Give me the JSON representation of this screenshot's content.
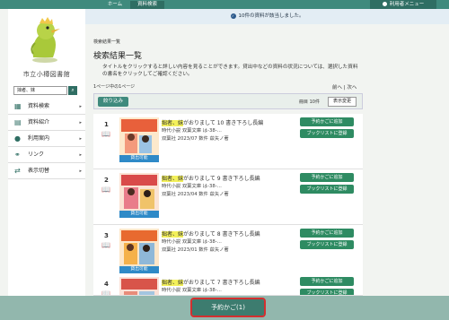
{
  "topnav": {
    "home": "ホーム",
    "search": "資料検索",
    "user_menu": "利用者メニュー"
  },
  "notice": "10件の資料が該当しました。",
  "sidebar": {
    "library_name": "市立小樽図書館",
    "search_value": "拙者、妹",
    "menu": [
      {
        "label": "資料検索",
        "icon": "book-search-icon"
      },
      {
        "label": "資料紹介",
        "icon": "book-intro-icon"
      },
      {
        "label": "利用案内",
        "icon": "person-icon"
      },
      {
        "label": "リンク",
        "icon": "link-icon"
      },
      {
        "label": "表示切替",
        "icon": "switch-icon"
      }
    ]
  },
  "main": {
    "breadcrumb": "検索結果一覧",
    "title": "検索結果一覧",
    "description": "タイトルをクリックすると詳しい内容を見ることができます。貸出中などの資料の状況については、選択した資料の書名をクリックしてご確認ください。",
    "page_info": "1ページ中の1ページ",
    "pager_prev": "前へ",
    "pager_next": "次へ",
    "narrow_button": "絞り込み",
    "sort_label": "冊目 10件",
    "sort_button": "表示変更"
  },
  "results": [
    {
      "num": "1",
      "highlight": "拙者、妹",
      "title_rest": "がおりまして 10 書き下ろし長編",
      "meta1": "時代小説 双葉文庫 は-38-…",
      "meta2": "双葉社 2023/07 数件 茲矢ノ著",
      "status": "貸出可能",
      "add": "予約かごに追加",
      "bookmark": "ブックリストに登録"
    },
    {
      "num": "2",
      "highlight": "拙者、妹",
      "title_rest": "がおりまして 9 書き下ろし長編",
      "meta1": "時代小説 双葉文庫 は-38-…",
      "meta2": "双葉社 2023/04 数件 茲矢ノ著",
      "status": "貸出可能",
      "add": "予約かごに追加",
      "bookmark": "ブックリストに登録"
    },
    {
      "num": "3",
      "highlight": "拙者、妹",
      "title_rest": "がおりまして 8 書き下ろし長編",
      "meta1": "時代小説 双葉文庫 は-38-…",
      "meta2": "双葉社 2023/01 数件 茲矢ノ著",
      "status": "貸出可能",
      "add": "予約かごに追加",
      "bookmark": "ブックリストに登録"
    },
    {
      "num": "4",
      "highlight": "拙者、妹",
      "title_rest": "がおりまして 7 書き下ろし長編",
      "meta1": "時代小説 双葉文庫 は-38-…",
      "meta2": "",
      "status": "",
      "add": "予約かごに追加",
      "bookmark": "ブックリストに登録"
    }
  ],
  "cart_button": "予約かご(1)",
  "colors": {
    "accent": "#3f8a7d",
    "button_green": "#2e8b62",
    "available_blue": "#2f8ac7",
    "highlight": "#f3f05a"
  }
}
